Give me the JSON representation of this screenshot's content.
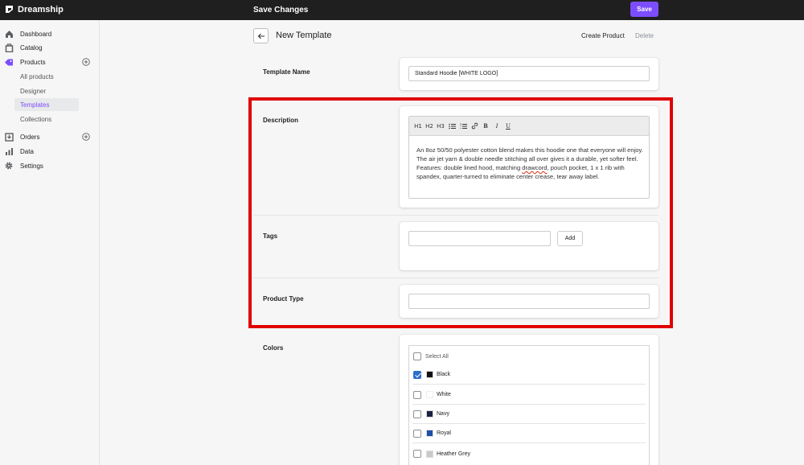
{
  "app": {
    "name": "Dreamship"
  },
  "topbar": {
    "status": "Save Changes",
    "save_label": "Save"
  },
  "sidebar": {
    "items": [
      {
        "label": "Dashboard",
        "icon": "home-icon"
      },
      {
        "label": "Catalog",
        "icon": "catalog-icon"
      },
      {
        "label": "Products",
        "icon": "tag-icon"
      },
      {
        "label": "All products"
      },
      {
        "label": "Designer"
      },
      {
        "label": "Templates"
      },
      {
        "label": "Collections"
      },
      {
        "label": "Orders",
        "icon": "orders-icon"
      },
      {
        "label": "Data",
        "icon": "chart-icon"
      },
      {
        "label": "Settings",
        "icon": "gear-icon"
      }
    ]
  },
  "header": {
    "title": "New Template",
    "create_product": "Create Product",
    "delete": "Delete"
  },
  "template_name": {
    "label": "Template Name",
    "value": "Standard Hoodie [WHITE LOGO]"
  },
  "description": {
    "label": "Description",
    "toolbar": [
      "H1",
      "H2",
      "H3",
      "•≡",
      "1≡",
      "🔗",
      "B",
      "I",
      "U"
    ],
    "text_before": "An 8oz 50/50 polyester cotton blend makes this hoodie one that everyone will enjoy. The air jet yarn & double needle stitching all over gives it a durable, yet softer feel. Features: double lined hood, matching ",
    "text_spell": "drawcord",
    "text_after": ", pouch pocket, 1 x 1 rib with spandex, quarter-turned to eliminate center crease, tear away label."
  },
  "tags": {
    "label": "Tags",
    "value": "",
    "add_label": "Add"
  },
  "product_type": {
    "label": "Product Type",
    "value": ""
  },
  "colors": {
    "label": "Colors",
    "select_all": "Select All",
    "items": [
      {
        "name": "Black",
        "hex": "#111111",
        "checked": true
      },
      {
        "name": "White",
        "hex": "#ffffff",
        "checked": false
      },
      {
        "name": "Navy",
        "hex": "#1b2140",
        "checked": false
      },
      {
        "name": "Royal",
        "hex": "#1f4ea8",
        "checked": false
      },
      {
        "name": "Heather Grey",
        "hex": "#c9c9c9",
        "checked": false
      }
    ]
  },
  "theme": {
    "accent": "#7c4dff",
    "highlight": "#e00000"
  }
}
